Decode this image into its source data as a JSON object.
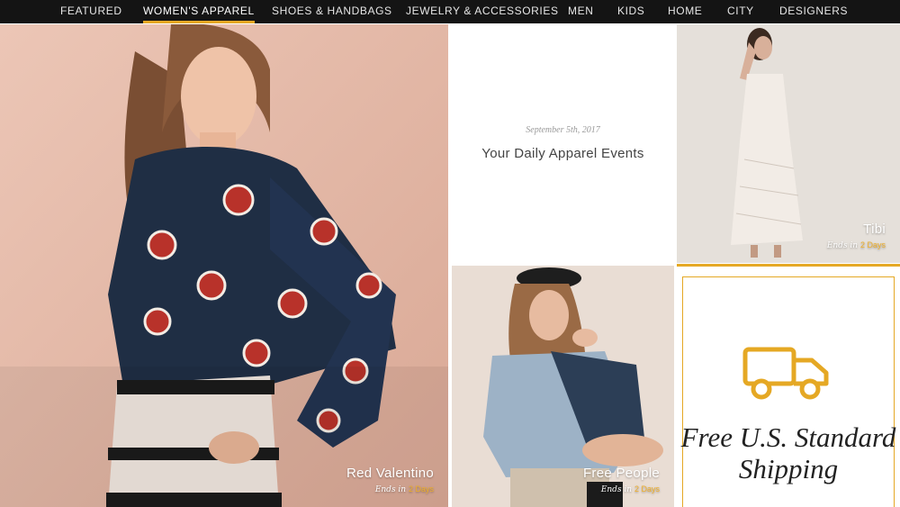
{
  "nav": {
    "items": [
      {
        "label": "FEATURED",
        "active": false
      },
      {
        "label": "WOMEN'S APPAREL",
        "active": true
      },
      {
        "label": "SHOES & HANDBAGS",
        "active": false
      },
      {
        "label": "JEWELRY & ACCESSORIES",
        "active": false
      },
      {
        "label": "MEN",
        "active": false
      },
      {
        "label": "KIDS",
        "active": false
      },
      {
        "label": "HOME",
        "active": false
      },
      {
        "label": "CITY",
        "active": false
      },
      {
        "label": "DESIGNERS",
        "active": false
      }
    ],
    "accent_color": "#e5a824"
  },
  "events": {
    "date": "September 5th, 2017",
    "title": "Your Daily Apparel Events"
  },
  "tiles": {
    "red_valentino": {
      "brand": "Red Valentino",
      "ends_prefix": "Ends in",
      "ends_value": "2 Days"
    },
    "tibi": {
      "brand": "Tibi",
      "ends_prefix": "Ends in",
      "ends_value": "2 Days"
    },
    "free_people": {
      "brand": "Free People",
      "ends_prefix": "Ends in",
      "ends_value": "2 Days"
    }
  },
  "shipping": {
    "icon": "truck-icon",
    "text": "Free U.S. Standard Shipping"
  }
}
